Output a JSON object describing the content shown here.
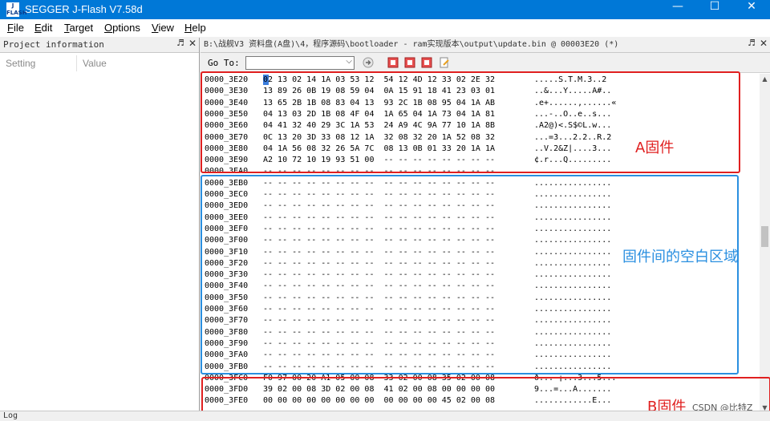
{
  "window": {
    "title": "SEGGER J-Flash V7.58d",
    "icon_text": "J\nFLASH",
    "controls": {
      "minimize": "—",
      "maximize": "☐",
      "close": "✕"
    }
  },
  "menu": [
    {
      "key": "F",
      "rest": "ile"
    },
    {
      "key": "E",
      "rest": "dit"
    },
    {
      "key": "T",
      "rest": "arget"
    },
    {
      "key": "O",
      "rest": "ptions"
    },
    {
      "key": "V",
      "rest": "iew"
    },
    {
      "key": "H",
      "rest": "elp"
    }
  ],
  "project_panel": {
    "title": "Project information",
    "pin": "♬",
    "close": "✕",
    "columns": [
      "Setting",
      "Value"
    ]
  },
  "file_panel": {
    "title": "B:\\战舰V3 资料盘(A盘)\\4，程序源码\\bootloader - ram实现版本\\output\\update.bin @ 00003E20 (*)",
    "pin": "♬",
    "close": "✕",
    "goto_label": "Go To:",
    "goto_value": ""
  },
  "hex_rows": [
    {
      "addr": "0000_3E20",
      "bytes": "02 13 02 14 1A 03 53 12  54 12 4D 12 33 02 2E 32",
      "ascii": ".....S.T.M.3..2"
    },
    {
      "addr": "0000_3E30",
      "bytes": "13 89 26 0B 19 08 59 04  0A 15 91 18 41 23 03 01",
      "ascii": "..&...Y.....A#.."
    },
    {
      "addr": "0000_3E40",
      "bytes": "13 65 2B 1B 08 83 04 13  93 2C 1B 08 95 04 1A AB",
      "ascii": ".e+......,......«"
    },
    {
      "addr": "0000_3E50",
      "bytes": "04 13 03 2D 1B 08 4F 04  1A 65 04 1A 73 04 1A 81",
      "ascii": "...-..O..e..s..."
    },
    {
      "addr": "0000_3E60",
      "bytes": "04 41 32 40 29 3C 1A 53  24 A9 4C 9A 77 10 1A 8B",
      "ascii": ".A2@)<.S$©L.w..."
    },
    {
      "addr": "0000_3E70",
      "bytes": "0C 13 20 3D 33 08 12 1A  32 08 32 20 1A 52 08 32",
      "ascii": "...=3...2.2..R.2"
    },
    {
      "addr": "0000_3E80",
      "bytes": "04 1A 56 08 32 26 5A 7C  08 13 0B 01 33 20 1A 1A",
      "ascii": "..V.2&Z|....3..."
    },
    {
      "addr": "0000_3E90",
      "bytes": "A2 10 72 10 19 93 51 00  -- -- -- -- -- -- -- --",
      "ascii": "¢.r...Q........."
    },
    {
      "addr": "0000_3EA0",
      "bytes": "-- -- -- -- -- -- -- --  -- -- -- -- -- -- -- --",
      "ascii": "................"
    },
    {
      "addr": "0000_3EB0",
      "bytes": "-- -- -- -- -- -- -- --  -- -- -- -- -- -- -- --",
      "ascii": "................"
    },
    {
      "addr": "0000_3EC0",
      "bytes": "-- -- -- -- -- -- -- --  -- -- -- -- -- -- -- --",
      "ascii": "................"
    },
    {
      "addr": "0000_3ED0",
      "bytes": "-- -- -- -- -- -- -- --  -- -- -- -- -- -- -- --",
      "ascii": "................"
    },
    {
      "addr": "0000_3EE0",
      "bytes": "-- -- -- -- -- -- -- --  -- -- -- -- -- -- -- --",
      "ascii": "................"
    },
    {
      "addr": "0000_3EF0",
      "bytes": "-- -- -- -- -- -- -- --  -- -- -- -- -- -- -- --",
      "ascii": "................"
    },
    {
      "addr": "0000_3F00",
      "bytes": "-- -- -- -- -- -- -- --  -- -- -- -- -- -- -- --",
      "ascii": "................"
    },
    {
      "addr": "0000_3F10",
      "bytes": "-- -- -- -- -- -- -- --  -- -- -- -- -- -- -- --",
      "ascii": "................"
    },
    {
      "addr": "0000_3F20",
      "bytes": "-- -- -- -- -- -- -- --  -- -- -- -- -- -- -- --",
      "ascii": "................"
    },
    {
      "addr": "0000_3F30",
      "bytes": "-- -- -- -- -- -- -- --  -- -- -- -- -- -- -- --",
      "ascii": "................"
    },
    {
      "addr": "0000_3F40",
      "bytes": "-- -- -- -- -- -- -- --  -- -- -- -- -- -- -- --",
      "ascii": "................"
    },
    {
      "addr": "0000_3F50",
      "bytes": "-- -- -- -- -- -- -- --  -- -- -- -- -- -- -- --",
      "ascii": "................"
    },
    {
      "addr": "0000_3F60",
      "bytes": "-- -- -- -- -- -- -- --  -- -- -- -- -- -- -- --",
      "ascii": "................"
    },
    {
      "addr": "0000_3F70",
      "bytes": "-- -- -- -- -- -- -- --  -- -- -- -- -- -- -- --",
      "ascii": "................"
    },
    {
      "addr": "0000_3F80",
      "bytes": "-- -- -- -- -- -- -- --  -- -- -- -- -- -- -- --",
      "ascii": "................"
    },
    {
      "addr": "0000_3F90",
      "bytes": "-- -- -- -- -- -- -- --  -- -- -- -- -- -- -- --",
      "ascii": "................"
    },
    {
      "addr": "0000_3FA0",
      "bytes": "-- -- -- -- -- -- -- --  -- -- -- -- -- -- -- --",
      "ascii": "................"
    },
    {
      "addr": "0000_3FB0",
      "bytes": "-- -- -- -- -- -- -- --  -- -- -- -- -- -- -- --",
      "ascii": "................"
    },
    {
      "addr": "0000_3FC0",
      "bytes": "F0 97 00 20 A1 05 00 08  33 02 00 08 35 02 00 08",
      "ascii": "ð... ¡...3...5..."
    },
    {
      "addr": "0000_3FD0",
      "bytes": "39 02 00 08 3D 02 00 08  41 02 00 08 00 00 00 00",
      "ascii": "9...=...A......."
    },
    {
      "addr": "0000_3FE0",
      "bytes": "00 00 00 00 00 00 00 00  00 00 00 00 45 02 00 08",
      "ascii": "............E..."
    }
  ],
  "annotations": {
    "a_firmware": "A固件",
    "gap": "固件间的空白区域",
    "b_firmware": "B固件"
  },
  "colors": {
    "titlebar": "#0078d7",
    "box_a": "#e02020",
    "box_gap": "#2a8fe0",
    "box_b": "#e02020",
    "label_a": "#e02020",
    "label_gap": "#2a8fe0",
    "label_b": "#e02020"
  },
  "watermark": "CSDN @比特Z",
  "status": {
    "log_label": "Log"
  }
}
